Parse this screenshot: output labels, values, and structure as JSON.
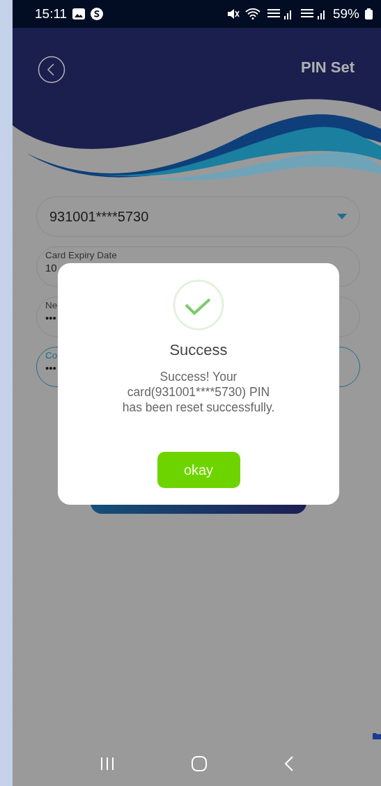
{
  "status_bar": {
    "time": "15:11",
    "battery": "59%"
  },
  "header": {
    "title": "PIN Set"
  },
  "form": {
    "card_select": {
      "value": "931001****5730"
    },
    "fields": [
      {
        "label": "Card Expiry Date",
        "value": "10",
        "focused": false
      },
      {
        "label": "Ne",
        "value": "•••",
        "focused": false
      },
      {
        "label": "Co",
        "value": "•••",
        "focused": true
      }
    ]
  },
  "dialog": {
    "title": "Success",
    "message_lines": [
      "Success! Your",
      "card(931001****5730) PIN",
      "has been reset successfully."
    ],
    "button": "okay"
  }
}
